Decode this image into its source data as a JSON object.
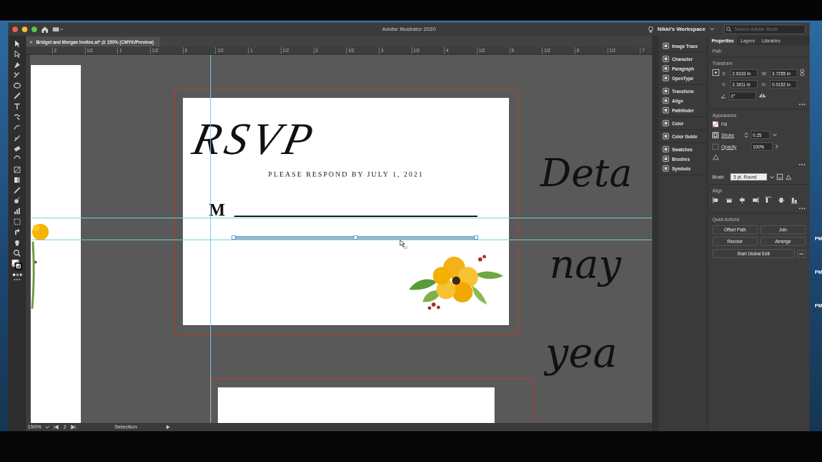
{
  "window": {
    "title": "Adobe Illustrator 2020",
    "workspace": "Nikki's Workspace",
    "search": {
      "placeholder": "Search Adobe Stock"
    }
  },
  "document_tab": {
    "close": "×",
    "label": "Bridget and Morgan Invites.ai* @ 150% (CMYK/Preview)"
  },
  "ruler": {
    "labels": [
      "2",
      "1/2",
      "1",
      "1/2",
      "0",
      "1/2",
      "1",
      "1/2",
      "2",
      "1/2",
      "3",
      "1/2",
      "4",
      "1/2",
      "5",
      "1/2",
      "6",
      "1/2",
      "7"
    ]
  },
  "artboard": {
    "title": "RSVP",
    "subtitle": "PLEASE RESPOND BY JULY 1, 2021",
    "name_prefix": "M"
  },
  "offcanvas_script": [
    "Deta",
    "nay",
    "yea"
  ],
  "dock": {
    "groups": [
      {
        "items": [
          "Image Trace"
        ]
      },
      {
        "items": [
          "Character",
          "Paragraph",
          "OpenType"
        ]
      },
      {
        "items": [
          "Transform",
          "Align",
          "Pathfinder"
        ]
      },
      {
        "items": [
          "Color"
        ]
      },
      {
        "items": [
          "Color Guide"
        ]
      },
      {
        "items": [
          "Swatches",
          "Brushes",
          "Symbols"
        ]
      }
    ]
  },
  "properties": {
    "tabs": [
      {
        "label": "Properties",
        "selected": true
      },
      {
        "label": "Layers",
        "selected": false
      },
      {
        "label": "Libraries",
        "selected": false
      }
    ],
    "object_type": "Path",
    "transform": {
      "heading": "Transform",
      "fields": [
        {
          "label": "X:",
          "value": "2.6333 in"
        },
        {
          "label": "W:",
          "value": "3.7255 in"
        },
        {
          "label": "Y:",
          "value": "2.1811 in"
        },
        {
          "label": "H:",
          "value": "0.0152 in"
        }
      ],
      "angle": "0°"
    },
    "appearance": {
      "heading": "Appearance",
      "fill_label": "Fill",
      "stroke_label": "Stroke",
      "stroke_value": "0.25",
      "opacity_label": "Opacity",
      "opacity_value": "100%"
    },
    "brush": {
      "label": "Brush",
      "value": "5 pt. Round"
    },
    "align": {
      "heading": "Align"
    },
    "quick_actions": {
      "heading": "Quick Actions",
      "buttons": [
        "Offset Path",
        "Join",
        "Recolor",
        "Arrange"
      ],
      "wide_button": "Start Global Edit"
    }
  },
  "status_bar": {
    "zoom": "150%",
    "artboard": "2",
    "tool": "Selection"
  },
  "desktop": {
    "clock_labels": [
      "PM",
      "PM",
      "PM"
    ]
  }
}
